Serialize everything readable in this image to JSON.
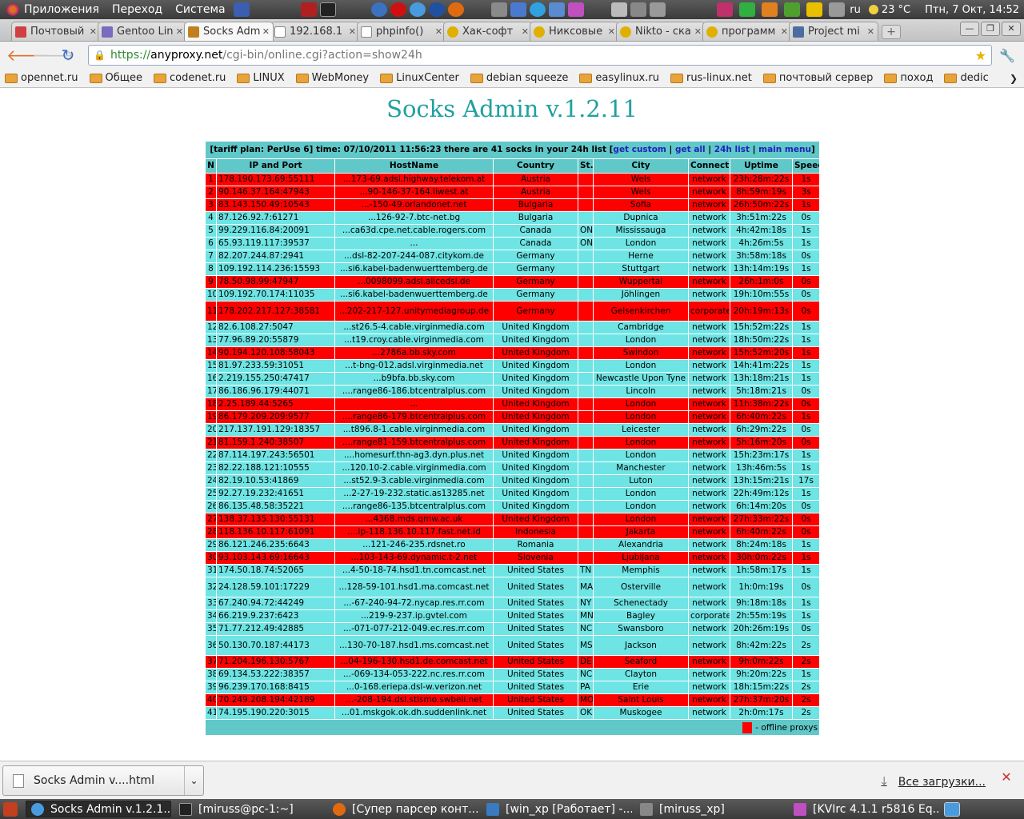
{
  "panel": {
    "menus": [
      "Приложения",
      "Переход",
      "Система"
    ],
    "lang": "ru",
    "weather": "23 °C",
    "clock": "Птн, 7 Окт, 14:52"
  },
  "tabs": [
    {
      "title": "Почтовый",
      "active": false
    },
    {
      "title": "Gentoo Lin",
      "active": false
    },
    {
      "title": "Socks Adm",
      "active": true
    },
    {
      "title": "192.168.1",
      "active": false
    },
    {
      "title": "phpinfo()",
      "active": false
    },
    {
      "title": "Хак-софт",
      "active": false
    },
    {
      "title": "Никсовые",
      "active": false
    },
    {
      "title": "Nikto - ска",
      "active": false
    },
    {
      "title": "программ",
      "active": false
    },
    {
      "title": "Project mi",
      "active": false
    }
  ],
  "address": {
    "scheme": "https://",
    "host": "anyproxy.net",
    "rest": "/cgi-bin/online.cgi?action=show24h"
  },
  "bookmarks": [
    "opennet.ru",
    "Общее",
    "codenet.ru",
    "LINUX",
    "WebMoney",
    "LinuxCenter",
    "debian squeeze",
    "easylinux.ru",
    "rus-linux.net",
    "почтовый сервер",
    "поход",
    "dedic"
  ],
  "page": {
    "title": "Socks Admin v.1.2.11",
    "info_prefix": "[tariff plan: PerUse 6]   time: 07/10/2011 11:56:23     there are 41 socks in your 24h list  [",
    "links": [
      "get custom",
      "get all",
      "24h list",
      "main menu"
    ],
    "headers": [
      "N",
      "IP and Port",
      "HostName",
      "Country",
      "St.",
      "City",
      "Connect",
      "Uptime",
      "Speed"
    ],
    "legend": "- offline proxys"
  },
  "rows": [
    [
      "1",
      "178.190.173.69:55111",
      "...173-69.adsl.highway.telekom.at",
      "Austria",
      "",
      "Wels",
      "network",
      "23h:28m:22s",
      "1s",
      "off"
    ],
    [
      "2",
      "90.146.37.164:47943",
      "...90-146-37-164.liwest.at",
      "Austria",
      "",
      "Wels",
      "network",
      "8h:59m:19s",
      "3s",
      "off"
    ],
    [
      "3",
      "83.143.150.49:10543",
      "...-150-49.orlandonet.net",
      "Bulgaria",
      "",
      "Sofia",
      "network",
      "26h:50m:22s",
      "1s",
      "off"
    ],
    [
      "4",
      "87.126.92.7:61271",
      "...126-92-7.btc-net.bg",
      "Bulgaria",
      "",
      "Dupnica",
      "network",
      "3h:51m:22s",
      "0s",
      "on"
    ],
    [
      "5",
      "99.229.116.84:20091",
      "...ca63d.cpe.net.cable.rogers.com",
      "Canada",
      "ON",
      "Mississauga",
      "network",
      "4h:42m:18s",
      "1s",
      "on"
    ],
    [
      "6",
      "65.93.119.117:39537",
      "...",
      "Canada",
      "ON",
      "London",
      "network",
      "4h:26m:5s",
      "1s",
      "on"
    ],
    [
      "7",
      "82.207.244.87:2941",
      "...dsl-82-207-244-087.citykom.de",
      "Germany",
      "",
      "Herne",
      "network",
      "3h:58m:18s",
      "0s",
      "on"
    ],
    [
      "8",
      "109.192.114.236:15593",
      "...si6.kabel-badenwuerttemberg.de",
      "Germany",
      "",
      "Stuttgart",
      "network",
      "13h:14m:19s",
      "1s",
      "on"
    ],
    [
      "9",
      "78.50.98.99:47947",
      "...0098099.adsl.alicedsl.de",
      "Germany",
      "",
      "Wuppertal",
      "network",
      "26h:1m:0s",
      "0s",
      "off"
    ],
    [
      "10",
      "109.192.70.174:11035",
      "...si6.kabel-badenwuerttemberg.de",
      "Germany",
      "",
      "Jöhlingen",
      "network",
      "19h:10m:55s",
      "0s",
      "on"
    ],
    [
      "11",
      "178.202.217.127:38581",
      "...202-217-127.unitymediagroup.de",
      "Germany",
      "",
      "Gelsenkirchen",
      "corporate",
      "20h:19m:13s",
      "0s",
      "off",
      "tall"
    ],
    [
      "12",
      "82.6.108.27:5047",
      "...st26.5-4.cable.virginmedia.com",
      "United Kingdom",
      "",
      "Cambridge",
      "network",
      "15h:52m:22s",
      "1s",
      "on"
    ],
    [
      "13",
      "77.96.89.20:55879",
      "...t19.croy.cable.virginmedia.com",
      "United Kingdom",
      "",
      "London",
      "network",
      "18h:50m:22s",
      "1s",
      "on"
    ],
    [
      "14",
      "90.194.120.108:58043",
      "...2786a.bb.sky.com",
      "United Kingdom",
      "",
      "Swindon",
      "network",
      "15h:52m:20s",
      "1s",
      "off"
    ],
    [
      "15",
      "81.97.233.59:31051",
      "...t-bng-012.adsl.virginmedia.net",
      "United Kingdom",
      "",
      "London",
      "network",
      "14h:41m:22s",
      "1s",
      "on"
    ],
    [
      "16",
      "2.219.155.250:47417",
      "...b9bfa.bb.sky.com",
      "United Kingdom",
      "",
      "Newcastle Upon Tyne",
      "network",
      "13h:18m:21s",
      "1s",
      "on"
    ],
    [
      "17",
      "86.186.96.179:44071",
      "....range86-186.btcentralplus.com",
      "United Kingdom",
      "",
      "Lincoln",
      "network",
      "5h:18m:21s",
      "0s",
      "on"
    ],
    [
      "18",
      "2.25.189.44:5265",
      "...",
      "United Kingdom",
      "",
      "London",
      "network",
      "11h:38m:22s",
      "0s",
      "off"
    ],
    [
      "19",
      "86.179.209.209:9577",
      "....range86-179.btcentralplus.com",
      "United Kingdom",
      "",
      "London",
      "network",
      "6h:40m:22s",
      "1s",
      "off"
    ],
    [
      "20",
      "217.137.191.129:18357",
      "...t896.8-1.cable.virginmedia.com",
      "United Kingdom",
      "",
      "Leicester",
      "network",
      "6h:29m:22s",
      "0s",
      "on"
    ],
    [
      "21",
      "81.159.1.240:38507",
      "....range81-159.btcentralplus.com",
      "United Kingdom",
      "",
      "London",
      "network",
      "5h:16m:20s",
      "0s",
      "off"
    ],
    [
      "22",
      "87.114.197.243:56501",
      "....homesurf.thn-ag3.dyn.plus.net",
      "United Kingdom",
      "",
      "London",
      "network",
      "15h:23m:17s",
      "1s",
      "on"
    ],
    [
      "23",
      "82.22.188.121:10555",
      "...120.10-2.cable.virginmedia.com",
      "United Kingdom",
      "",
      "Manchester",
      "network",
      "13h:46m:5s",
      "1s",
      "on"
    ],
    [
      "24",
      "82.19.10.53:41869",
      "...st52.9-3.cable.virginmedia.com",
      "United Kingdom",
      "",
      "Luton",
      "network",
      "13h:15m:21s",
      "17s",
      "on"
    ],
    [
      "25",
      "92.27.19.232:41651",
      "...2-27-19-232.static.as13285.net",
      "United Kingdom",
      "",
      "London",
      "network",
      "22h:49m:12s",
      "1s",
      "on"
    ],
    [
      "26",
      "86.135.48.58:35221",
      "....range86-135.btcentralplus.com",
      "United Kingdom",
      "",
      "London",
      "network",
      "6h:14m:20s",
      "0s",
      "on"
    ],
    [
      "27",
      "138.37.135.130:55131",
      "...4368.mds.qmw.ac.uk",
      "United Kingdom",
      "",
      "London",
      "network",
      "27h:33m:22s",
      "0s",
      "off"
    ],
    [
      "28",
      "118.136.10.117:61091",
      "....ip-118.136.10.117.fast.net.id",
      "Indonesia",
      "",
      "Jakarta",
      "network",
      "6h:40m:22s",
      "0s",
      "off"
    ],
    [
      "29",
      "86.121.246.235:6643",
      "...121-246-235.rdsnet.ro",
      "Romania",
      "",
      "Alexandria",
      "network",
      "8h:24m:18s",
      "1s",
      "on"
    ],
    [
      "30",
      "93.103.143.69:16643",
      "...103-143-69.dynamic.t-2.net",
      "Slovenia",
      "",
      "Ljubljana",
      "network",
      "30h:0m:22s",
      "1s",
      "off"
    ],
    [
      "31",
      "174.50.18.74:52065",
      "...4-50-18-74.hsd1.tn.comcast.net",
      "United States",
      "TN",
      "Memphis",
      "network",
      "1h:58m:17s",
      "1s",
      "on"
    ],
    [
      "32",
      "24.128.59.101:17229",
      "...128-59-101.hsd1.ma.comcast.net",
      "United States",
      "MA",
      "Osterville",
      "network",
      "1h:0m:19s",
      "0s",
      "on",
      "tall"
    ],
    [
      "33",
      "67.240.94.72:44249",
      "...-67-240-94-72.nycap.res.rr.com",
      "United States",
      "NY",
      "Schenectady",
      "network",
      "9h:18m:18s",
      "1s",
      "on"
    ],
    [
      "34",
      "66.219.9.237:6423",
      "...219-9-237.ip.gvtel.com",
      "United States",
      "MN",
      "Bagley",
      "corporate",
      "2h:55m:19s",
      "1s",
      "on"
    ],
    [
      "35",
      "71.77.212.49:42885",
      "...-071-077-212-049.ec.res.rr.com",
      "United States",
      "NC",
      "Swansboro",
      "network",
      "20h:26m:19s",
      "0s",
      "on"
    ],
    [
      "36",
      "50.130.70.187:44173",
      "...130-70-187.hsd1.ms.comcast.net",
      "United States",
      "MS",
      "Jackson",
      "network",
      "8h:42m:22s",
      "2s",
      "on",
      "tall"
    ],
    [
      "37",
      "71.204.196.130:5767",
      "...04-196-130.hsd1.de.comcast.net",
      "United States",
      "DE",
      "Seaford",
      "network",
      "9h:0m:22s",
      "2s",
      "off"
    ],
    [
      "38",
      "69.134.53.222:38357",
      "...-069-134-053-222.nc.res.rr.com",
      "United States",
      "NC",
      "Clayton",
      "network",
      "9h:20m:22s",
      "1s",
      "on"
    ],
    [
      "39",
      "96.239.170.168:8415",
      "...0-168.eriepa.dsl-w.verizon.net",
      "United States",
      "PA",
      "Erie",
      "network",
      "18h:15m:22s",
      "2s",
      "on"
    ],
    [
      "40",
      "70.249.208.194:42189",
      "...-208-194.dsl.stlsmo.swbell.net",
      "United States",
      "MO",
      "Saint Louis",
      "network",
      "27h:37m:20s",
      "2s",
      "off"
    ],
    [
      "41",
      "74.195.190.220:3015",
      "...01.mskgok.ok.dh.suddenlink.net",
      "United States",
      "OK",
      "Muskogee",
      "network",
      "2h:0m:17s",
      "2s",
      "on"
    ]
  ],
  "download": {
    "file": "Socks Admin v....html",
    "all_label": "Все загрузки..."
  },
  "taskbar": [
    {
      "label": "Socks Admin v.1.2.1...",
      "active": true
    },
    {
      "label": "[miruss@pc-1:~]",
      "active": false
    },
    {
      "label": "[Супер парсер конт...",
      "active": false
    },
    {
      "label": "[win_xp [Работает] -...",
      "active": false
    },
    {
      "label": "[miruss_xp]",
      "active": false
    },
    {
      "label": "[KVIrc 4.1.1 r5816 Eq...",
      "active": false
    }
  ],
  "colors": {
    "online_row": "#6ee4e4",
    "offline_row": "#ff0000",
    "header_bg": "#60c8c8",
    "title": "#20a0a0"
  }
}
